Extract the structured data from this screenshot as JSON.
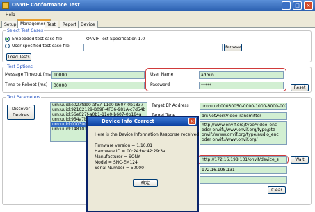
{
  "window": {
    "title": "ONVIF Conformance Test"
  },
  "menu": {
    "help": "Help"
  },
  "tabs": [
    "Setup",
    "Management",
    "Test",
    "Report",
    "Device"
  ],
  "select_test_cases": {
    "legend": "Select Test Cases",
    "embedded_label": "Embedded test case file",
    "user_specified_label": "User specified test case file",
    "spec_name": "ONVIF Test Specification 1.0",
    "browse": "Browse",
    "load_tests": "Load Tests"
  },
  "test_options": {
    "legend": "Test Options",
    "message_timeout_label": "Message Timeout (ms)",
    "message_timeout_value": "10000",
    "reboot_label": "Time to Reboot (ms)",
    "reboot_value": "30000",
    "username_label": "User Name",
    "username_value": "admin",
    "password_label": "Password",
    "password_value": "*****",
    "reset": "Reset"
  },
  "test_parameters": {
    "legend": "Test Parameters",
    "discover": "Discover Devices",
    "devices": [
      "urn:uuid:e027fdb0-af57-11e0-b607-0b1837",
      "urn:uuid:921C2129-B09F-4F36-981A-c7d54b",
      "urn:uuid:56e027f-a0b1-11e0-b607-0b184a",
      "urn:uuid:954a7b3f-a00c-11e0-a11a-0b1b2c",
      "urn:uuid:00030050-0000-1000-8000-0024ba",
      "urn:uuid:1481017a-a00c-11e0-8008-0b1b2c"
    ],
    "selected_index": 4,
    "ep_address_label": "Target EP Address",
    "ep_address_value": "urn:uuid:00030050-0000-1000-8000-0024ba",
    "target_type_label": "Target Type",
    "target_type_value": "dn:NetworkVideoTransmitter",
    "scopes": [
      "http://www.onvif.org/type/video_enc",
      "oder onvif://www.onvif.org/type/ptz",
      "onvif://www.onvif.org/type/audio_enc",
      "oder onvif://www.onvif.org/"
    ],
    "service_address": "http://172.16.198.131/onvif/device_s",
    "ip_address": "172.16.198.131",
    "wait": "Wait",
    "clear": "Clear"
  },
  "dialog": {
    "title": "Device Info Correct",
    "intro": "Here is the Device Information Response received",
    "lines": [
      "Firmware version = 1.10.01",
      "Hardware ID = 00:24:be:42:29:3a",
      "Manufacturer = SONY",
      "Model = SNC-EM124",
      "Serial Number = 50000T"
    ],
    "ok": "确定",
    "close_glyph": "×"
  },
  "window_buttons": {
    "minimize": "_",
    "maximize": "□",
    "close": "×"
  }
}
